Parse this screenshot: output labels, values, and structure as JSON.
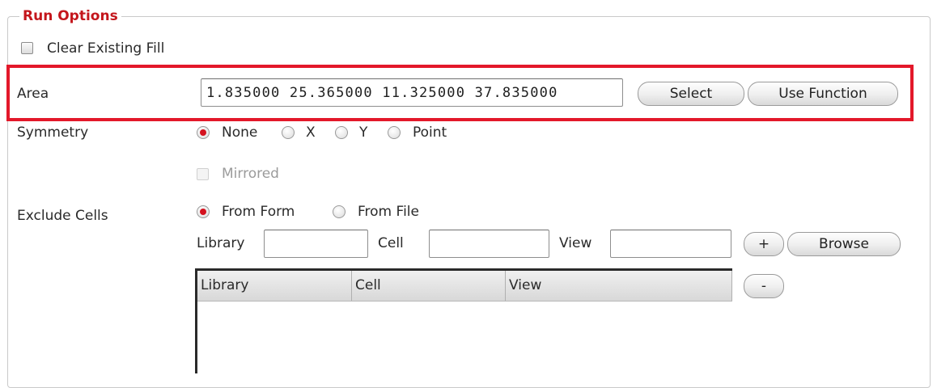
{
  "run_options": {
    "title": "Run Options",
    "clear_existing_fill": {
      "label": "Clear Existing Fill",
      "checked": false
    },
    "area": {
      "label": "Area",
      "value": "1.835000 25.365000 11.325000 37.835000",
      "select_label": "Select",
      "use_function_label": "Use Function",
      "highlight_color": "#e3182a"
    },
    "symmetry": {
      "label": "Symmetry",
      "options": [
        "None",
        "X",
        "Y",
        "Point"
      ],
      "selected": "None",
      "mirrored_label": "Mirrored",
      "mirrored_enabled": false
    },
    "exclude_cells": {
      "label": "Exclude Cells",
      "options": [
        "From Form",
        "From File"
      ],
      "selected": "From Form",
      "library_label": "Library",
      "cell_label": "Cell",
      "view_label": "View",
      "library_value": "",
      "cell_value": "",
      "view_value": "",
      "add_label": "+",
      "browse_label": "Browse",
      "remove_label": "-",
      "table": {
        "columns": [
          "Library",
          "Cell",
          "View"
        ],
        "rows": []
      }
    }
  },
  "colors": {
    "title": "#c4161c",
    "radio_checked": "#d4121f"
  }
}
